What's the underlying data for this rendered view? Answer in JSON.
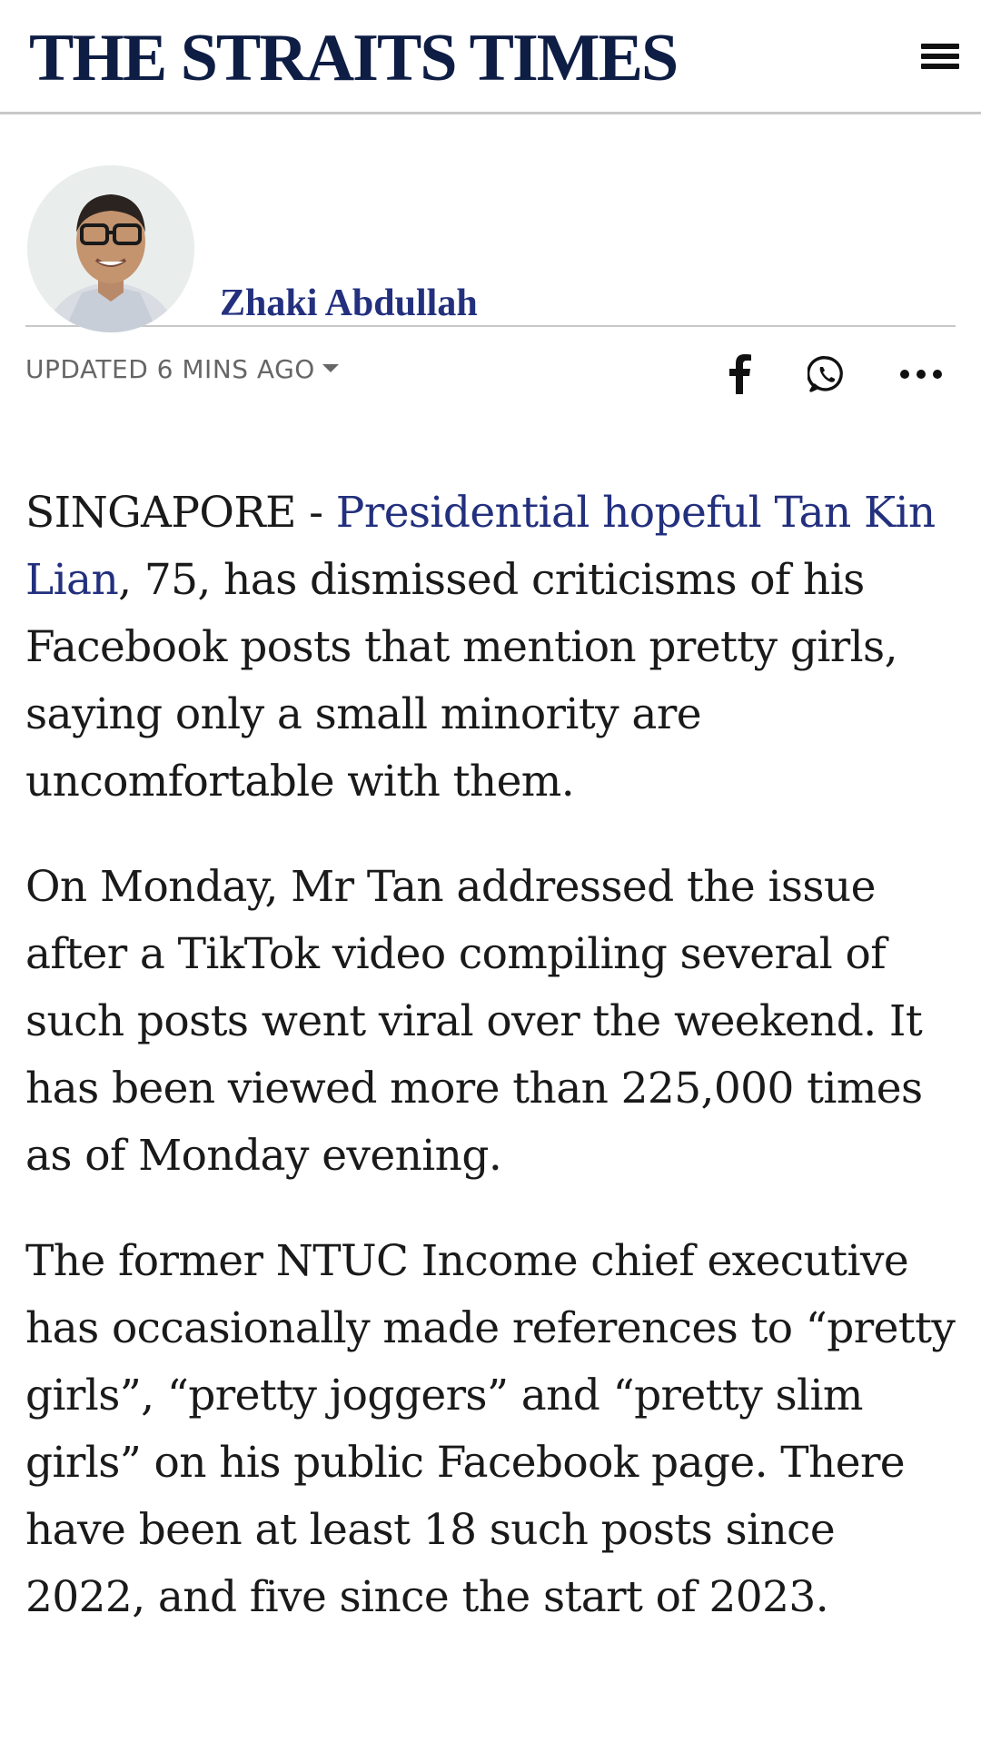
{
  "header": {
    "brand": "THE STRAITS TIMES",
    "menu_icon": "hamburger-menu-icon"
  },
  "author": {
    "name": "Zhaki Abdullah",
    "avatar_icon": "author-avatar"
  },
  "meta": {
    "updated": "UPDATED 6 MINS AGO",
    "share_icons": [
      "facebook-icon",
      "whatsapp-icon",
      "more-icon"
    ]
  },
  "article": {
    "p1_lead": "SINGAPORE - ",
    "p1_link": "Presidential hopeful Tan Kin Lian",
    "p1_rest": ", 75, has dismissed criticisms of his Facebook posts that mention pretty girls, saying only a small minority are uncomfortable with them.",
    "p2": "On Monday, Mr Tan addressed the issue after a TikTok video compiling several of such posts went viral over the weekend. It has been viewed more than 225,000 times as of Monday evening.",
    "p3": "The former NTUC Income chief executive has occasionally made references to “pretty girls”, “pretty joggers” and “pretty slim girls” on his public Facebook page. There have been at least 18 such posts since 2022, and five since the start of 2023."
  },
  "colors": {
    "brand": "#0e1d44",
    "link": "#23307e",
    "muted": "#666666",
    "divider": "#c8c8c8"
  }
}
